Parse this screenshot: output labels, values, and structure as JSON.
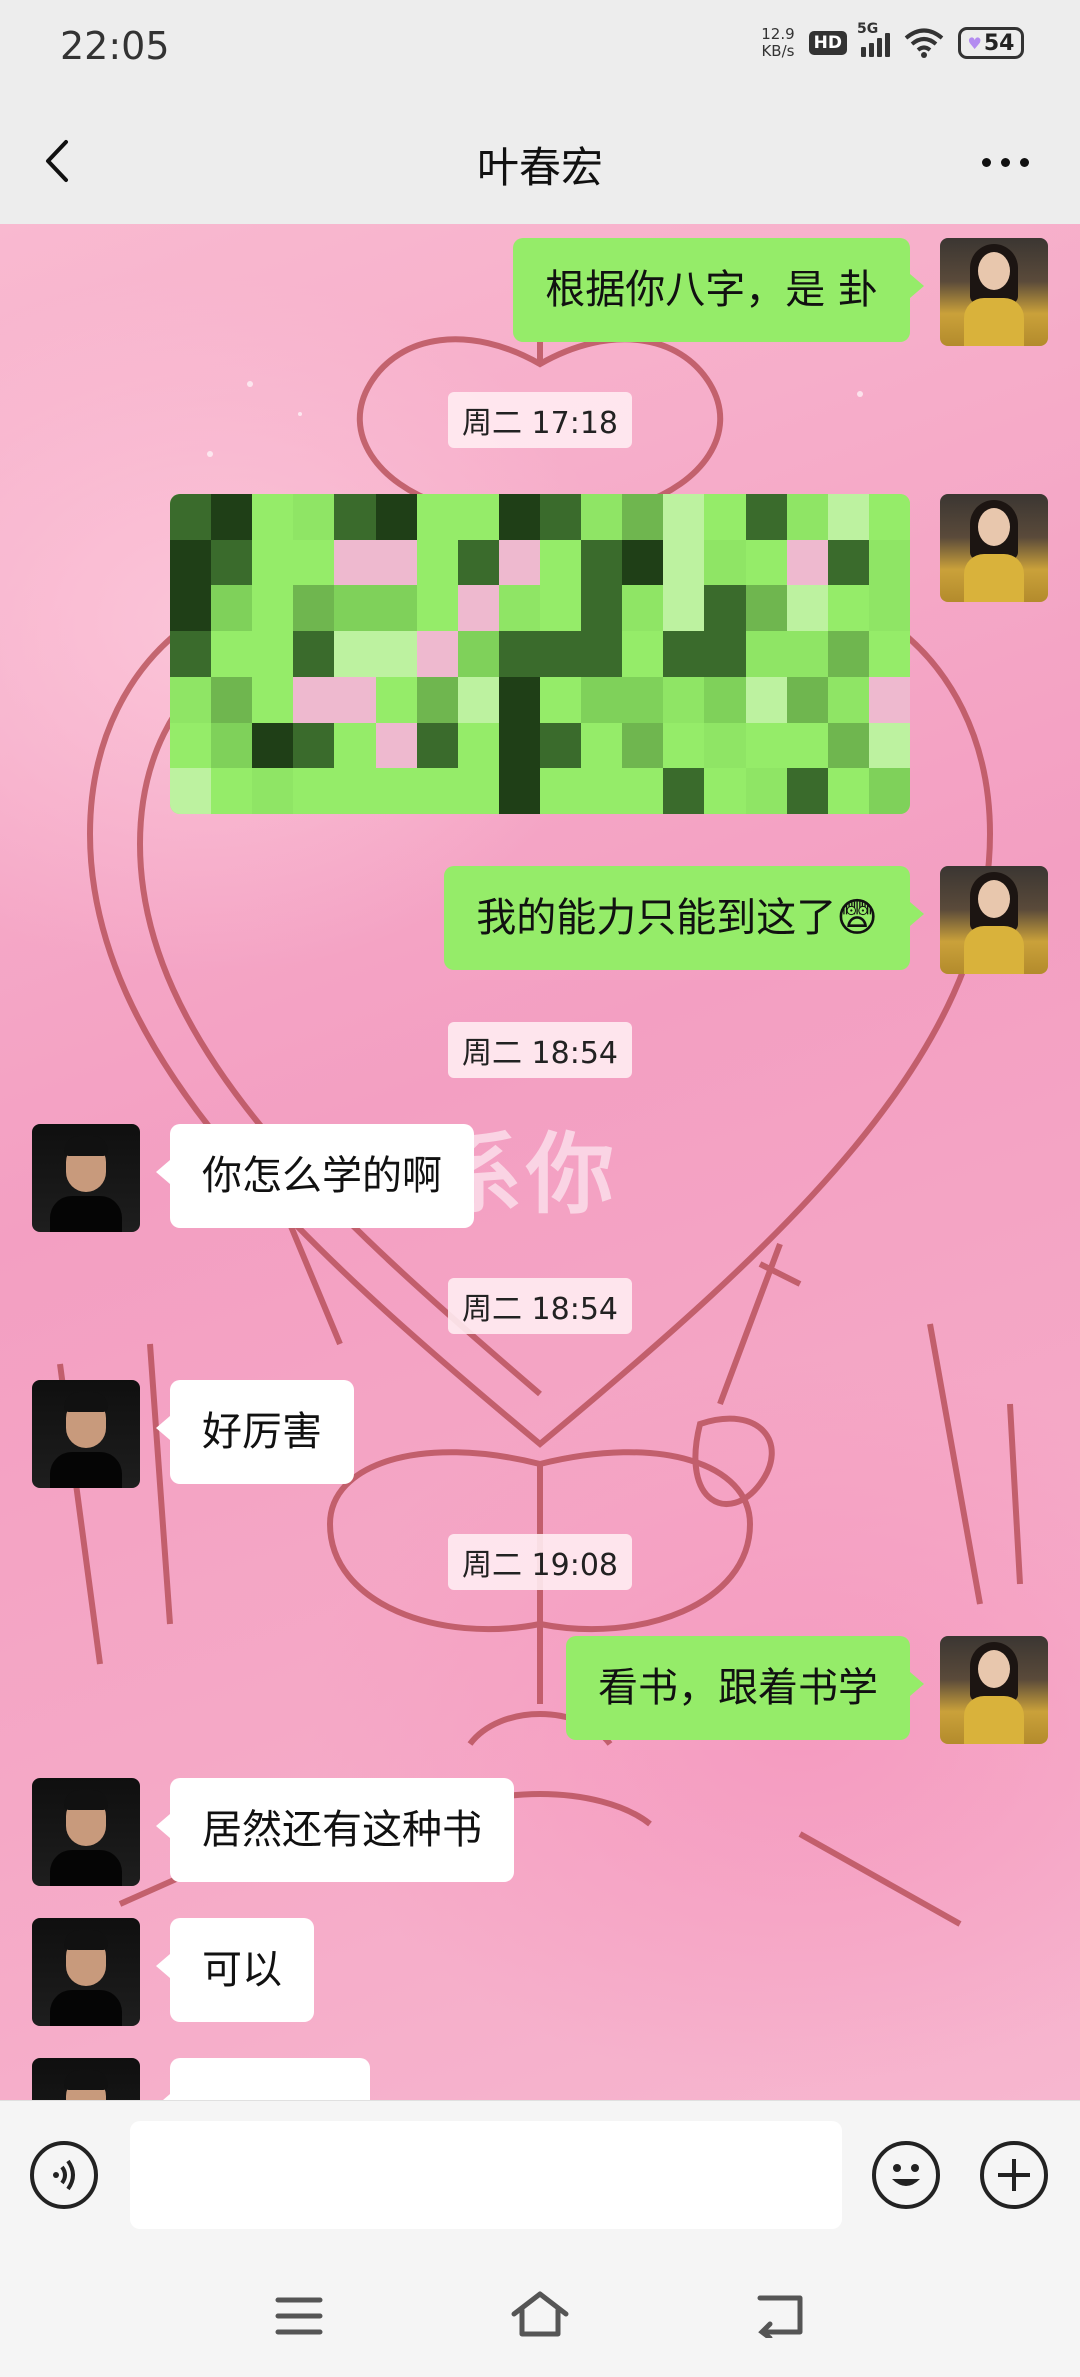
{
  "status_bar": {
    "time": "22:05",
    "net_speed_value": "12.9",
    "net_speed_unit": "KB/s",
    "hd_badge": "HD",
    "signal_label": "5G",
    "battery_level": "54"
  },
  "header": {
    "title": "叶春宏"
  },
  "wallpaper": {
    "overlay_text": "动联系你"
  },
  "messages": [
    {
      "sender": "me",
      "text": "根据你八字，是  卦"
    },
    {
      "type": "timestamp",
      "text": "周二 17:18"
    },
    {
      "sender": "me",
      "text": "",
      "pixelated": true
    },
    {
      "sender": "me",
      "text": "我的能力只能到这了😨"
    },
    {
      "type": "timestamp",
      "text": "周二 18:54"
    },
    {
      "sender": "them",
      "text": "你怎么学的啊"
    },
    {
      "type": "timestamp",
      "text": "周二 18:54"
    },
    {
      "sender": "them",
      "text": "好厉害"
    },
    {
      "type": "timestamp",
      "text": "周二 19:08"
    },
    {
      "sender": "me",
      "text": "看书，跟着书学"
    },
    {
      "sender": "them",
      "text": "居然还有这种书"
    },
    {
      "sender": "them",
      "text": "可以"
    }
  ],
  "input": {
    "value": "",
    "voice_icon": "voice-icon",
    "emoji_icon": "emoji-icon",
    "plus_icon": "plus-icon"
  },
  "navbar": {
    "icons": [
      "menu-icon",
      "home-icon",
      "back-nav-icon"
    ]
  },
  "colors": {
    "my_bubble": "#95ec69",
    "their_bubble": "#ffffff",
    "chrome": "#ededed"
  }
}
